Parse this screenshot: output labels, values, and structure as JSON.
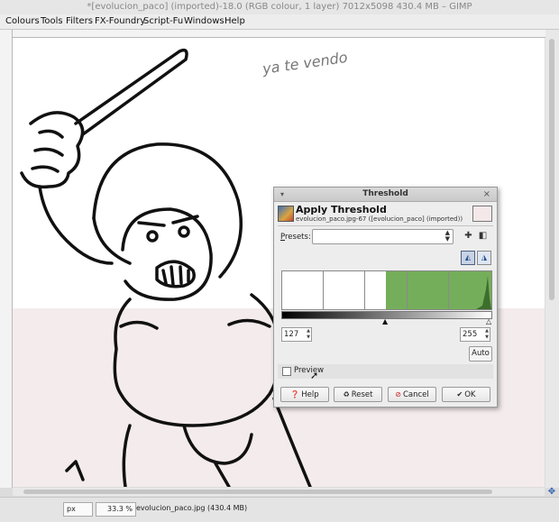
{
  "window": {
    "title": "*[evolucion_paco] (imported)-18.0 (RGB colour, 1 layer) 7012x5098 430.4 MB – GIMP"
  },
  "menu": [
    "Colours",
    "Tools",
    "Filters",
    "FX-Foundry",
    "Script-Fu",
    "Windows",
    "Help"
  ],
  "canvas": {
    "handwriting": "ya te vendo",
    "colors": {
      "paper": "#ffffff",
      "lower_tint": "#f4ebec",
      "ink": "#111111"
    }
  },
  "statusbar": {
    "unit": "px",
    "zoom": "33.3 %",
    "file_info": "evolucion_paco.jpg (430.4 MB)"
  },
  "dialog": {
    "window_title": "Threshold",
    "title": "Apply Threshold",
    "subtitle": "evolucion_paco.jpg-67 ([evolucion_paco] (imported))",
    "presets_label": "Presets:",
    "presets_value": "",
    "low_value": "127",
    "high_value": "255",
    "auto_label": "Auto",
    "preview_label": "Preview",
    "preview_checked": false,
    "buttons": {
      "help": "Help",
      "reset": "Reset",
      "cancel": "Cancel",
      "ok": "OK"
    },
    "histogram_color": "#74ae5a"
  }
}
